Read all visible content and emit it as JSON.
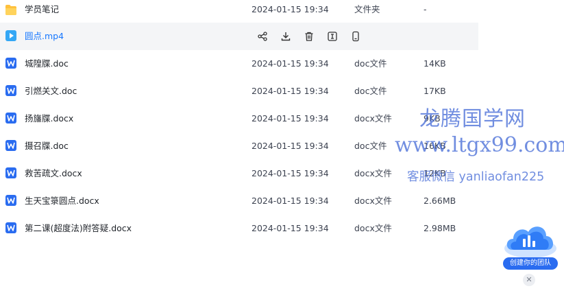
{
  "files": [
    {
      "name": "学员笔记",
      "date": "2024-01-15 19:34",
      "type": "文件夹",
      "size": "-",
      "icon": "folder-icon",
      "kind": "folder"
    },
    {
      "name": "圆点.mp4",
      "date": "",
      "type": "",
      "size": "",
      "icon": "video-file-icon",
      "kind": "video",
      "hover": true
    },
    {
      "name": "城隍牒.doc",
      "date": "2024-01-15 19:34",
      "type": "doc文件",
      "size": "14KB",
      "icon": "word-file-icon",
      "kind": "doc"
    },
    {
      "name": "引燃关文.doc",
      "date": "2024-01-15 19:34",
      "type": "doc文件",
      "size": "17KB",
      "icon": "word-file-icon",
      "kind": "doc"
    },
    {
      "name": "扬旛牒.docx",
      "date": "2024-01-15 19:34",
      "type": "docx文件",
      "size": "9KB",
      "icon": "word-file-icon",
      "kind": "doc"
    },
    {
      "name": "摄召牒.doc",
      "date": "2024-01-15 19:34",
      "type": "doc文件",
      "size": "16KB",
      "icon": "word-file-icon",
      "kind": "doc"
    },
    {
      "name": "救苦疏文.docx",
      "date": "2024-01-15 19:34",
      "type": "docx文件",
      "size": "12KB",
      "icon": "word-file-icon",
      "kind": "doc"
    },
    {
      "name": "生天宝箓圆点.docx",
      "date": "2024-01-15 19:34",
      "type": "docx文件",
      "size": "2.66MB",
      "icon": "word-file-icon",
      "kind": "doc"
    },
    {
      "name": "第二课(超度法)附答疑.docx",
      "date": "2024-01-15 19:34",
      "type": "docx文件",
      "size": "2.98MB",
      "icon": "word-file-icon",
      "kind": "doc"
    }
  ],
  "hover_actions": [
    {
      "name": "share",
      "icon": "share-icon"
    },
    {
      "name": "download",
      "icon": "download-icon"
    },
    {
      "name": "delete",
      "icon": "trash-icon"
    },
    {
      "name": "rename",
      "icon": "text-cursor-icon"
    },
    {
      "name": "phone",
      "icon": "mobile-icon"
    }
  ],
  "watermark": {
    "line1": "龙腾国学网",
    "line2": "www.ltgx99.com",
    "line3": "客服微信 yanliaofan225"
  },
  "team_badge": {
    "label": "创建你的团队",
    "icon": "cloud-chart-icon"
  },
  "close_icon": "close-icon",
  "colors": {
    "accent": "#1677ff",
    "word": "#2a6cf0",
    "folder": "#ffc13d",
    "video": "#34a7f5",
    "watermark": "#4a6fd8"
  }
}
